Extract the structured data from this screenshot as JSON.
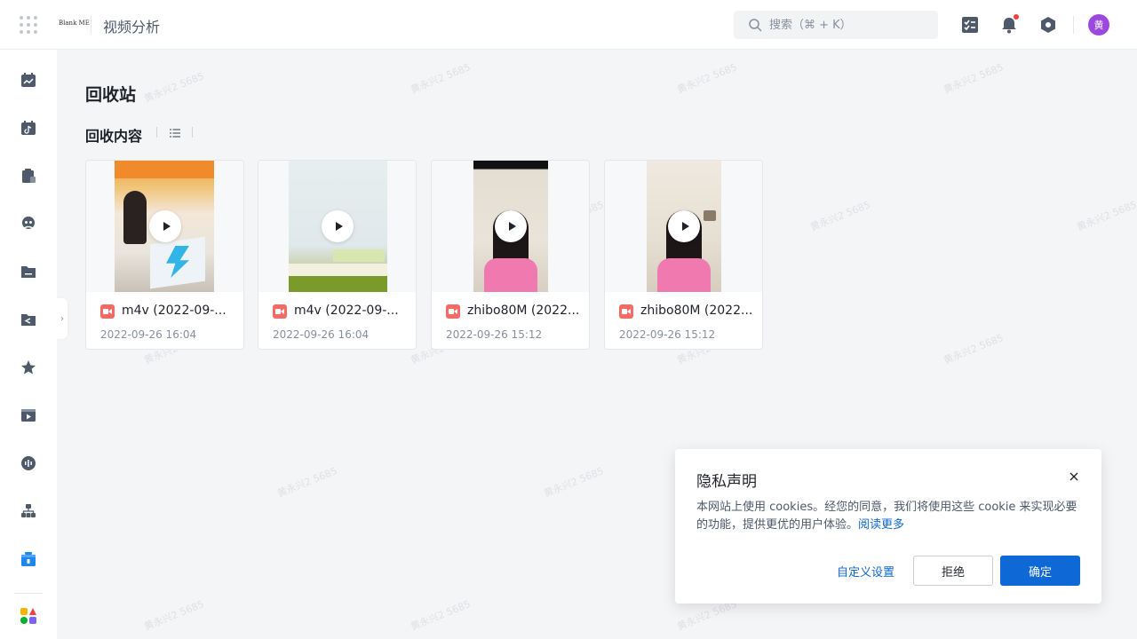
{
  "header": {
    "logo_text": "Blank ME",
    "title": "视频分析",
    "search_placeholder": "搜索（⌘ + K）",
    "avatar_text": "黄"
  },
  "sidebar": {
    "items": [
      {
        "icon": "calendar-chart-icon"
      },
      {
        "icon": "calendar-tiktok-icon"
      },
      {
        "icon": "shopping-bag-icon"
      },
      {
        "icon": "user-group-icon"
      },
      {
        "icon": "folder-icon"
      },
      {
        "icon": "folder-share-icon"
      },
      {
        "icon": "star-icon"
      },
      {
        "icon": "video-clip-icon"
      },
      {
        "icon": "audio-wave-icon"
      },
      {
        "icon": "org-chart-icon"
      },
      {
        "icon": "gift-box-icon"
      },
      {
        "icon": "apps-icon"
      }
    ]
  },
  "main": {
    "page_title": "回收站",
    "section_title": "回收内容",
    "cards": [
      {
        "name": "m4v (2022-09-...",
        "date": "2022-09-26 16:04"
      },
      {
        "name": "m4v (2022-09-...",
        "date": "2022-09-26 16:04"
      },
      {
        "name": "zhibo80M (2022...",
        "date": "2022-09-26 15:12"
      },
      {
        "name": "zhibo80M (2022...",
        "date": "2022-09-26 15:12"
      }
    ]
  },
  "privacy_dialog": {
    "title": "隐私声明",
    "body": "本网站上使用 cookies。经您的同意，我们将使用这些 cookie 来实现必要的功能，提供更优的用户体验。",
    "read_more": "阅读更多",
    "custom_settings": "自定义设置",
    "reject": "拒绝",
    "confirm": "确定"
  },
  "watermark": "黄永兴2 5685",
  "colors": {
    "primary": "#0e68d6",
    "avatar_bg": "#9a48e0",
    "video_file": "#f76965"
  }
}
